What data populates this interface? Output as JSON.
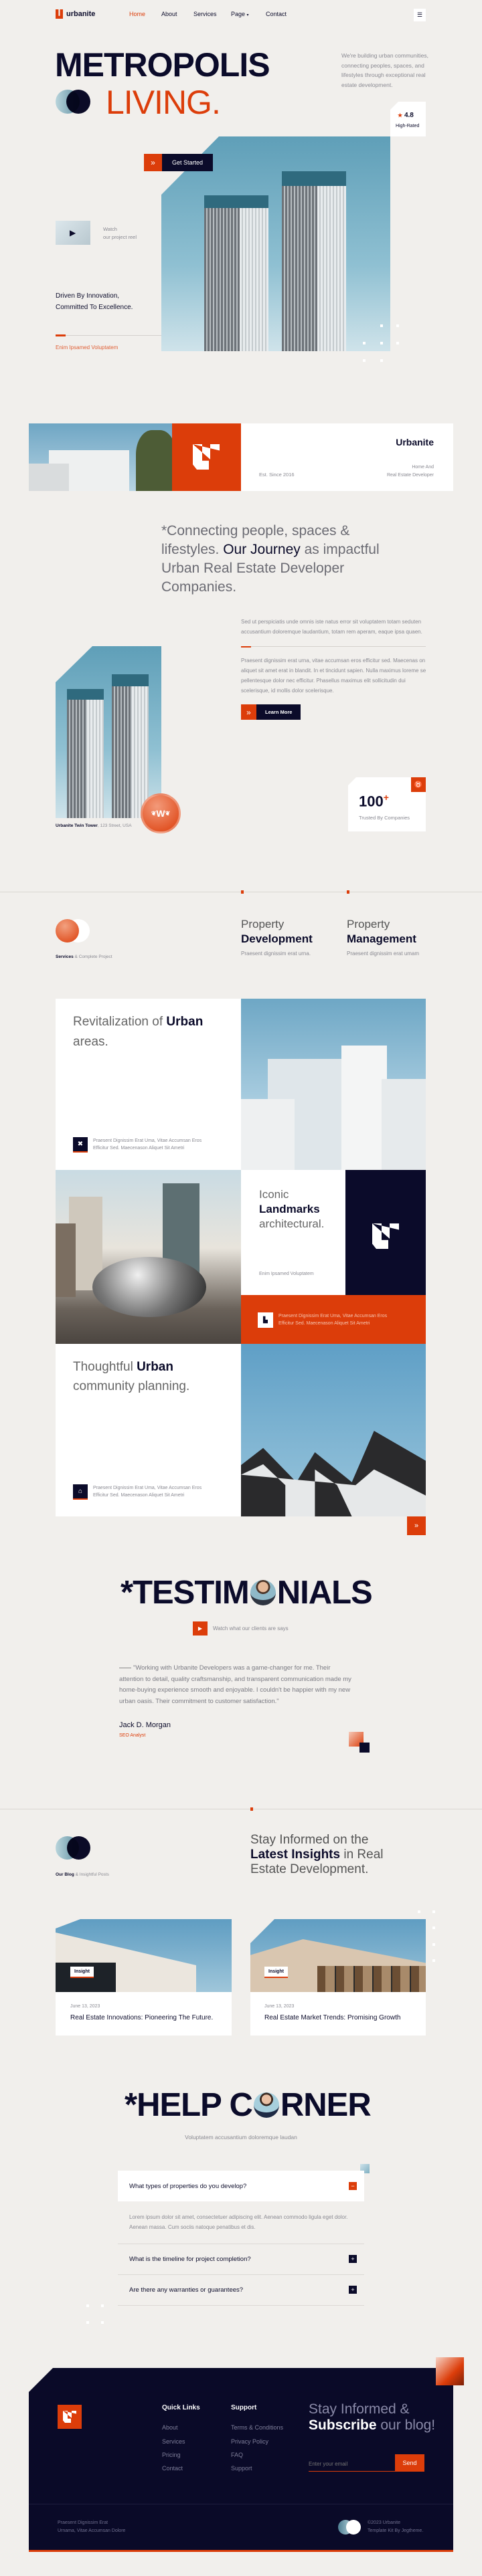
{
  "colors": {
    "accent": "#dc3d0a",
    "navy": "#0b0b2a",
    "background": "#f1efec"
  },
  "nav": {
    "brand": "urbanite",
    "items": [
      {
        "label": "Home",
        "active": true
      },
      {
        "label": "About"
      },
      {
        "label": "Services"
      },
      {
        "label": "Page",
        "dropdown": true
      },
      {
        "label": "Contact"
      }
    ],
    "menu_icon": "hamburger-icon"
  },
  "hero": {
    "title_line1": "METROPOLIS",
    "title_line2": "LIVING.",
    "intro": "We're building urban communities, connecting peoples, spaces, and lifestyles through exceptional real estate development.",
    "rating": {
      "value": "4.8",
      "label": "High-Rated"
    },
    "cta": "Get Started",
    "video": {
      "line1": "Watch",
      "line2": "our project reel"
    },
    "tagline1": "Driven By Innovation,",
    "tagline2": "Committed To Excellence.",
    "caption": "Enim Ipsamed Voluptatem"
  },
  "banner": {
    "name": "Urbanite",
    "est": "Est. Since 2016",
    "desc1": "Home And",
    "desc2": "Real Estate Developer"
  },
  "about": {
    "quote_pre": "*Connecting people, spaces & lifestyles. ",
    "quote_bold": "Our Journey",
    "quote_post": " as impactful Urban Real Estate Developer Companies.",
    "para1": "Sed ut perspiciatis unde omnis iste natus error sit voluptatem totam seduten accusantium doloremque laudantium, totam rem aperam, eaque ipsa quaen.",
    "para2": "Praesent dignissim erat urna, vitae accumsan eros efficitur sed. Maecenas on aliquet sit amet erat in blandit. In et tincidunt sapien. Nulla maximus loreme se pellentesque dolor nec efficitur. Phasellus maximus elit sollicitudin dui scelerisque, id mollis dolor scelerisque.",
    "cta": "Learn More",
    "tower_caption_bold": "Urbanite Twin Tower",
    "tower_caption": ", 123 Street, USA",
    "award_letter": "W",
    "stat_value": "100",
    "stat_suffix": "+",
    "stat_label": "Trusted By Companies"
  },
  "services": {
    "label_bold": "Services",
    "label": " & Complete Project",
    "items": [
      {
        "line1": "Property",
        "line2": "Development",
        "desc": "Praesent dignissim erat urna."
      },
      {
        "line1": "Property",
        "line2": "Management",
        "desc": "Praesent dignissim erat umam"
      }
    ],
    "cards": [
      {
        "pre": "Revitalization of ",
        "bold": "Urban",
        "post": "areas.",
        "text1": "Praesent Dignissim Erat Uma, Vitae Accumsan Eros",
        "text2": "Efficitur Sed. Maecenason Aliquet Sit Ametri",
        "icon": "tools-icon"
      },
      {
        "pre": "Iconic",
        "bold": "Landmarks",
        "post": "architectural.",
        "caption": "Enim Ipsamed Voluptatem",
        "text1": "Praesent Dignissim Erat Uma, Vitae Accumsan Eros",
        "text2": "Efficitur Sed. Maecenason Aliquet Sit Ametri",
        "icon": "factory-icon"
      },
      {
        "pre": "Thoughtful ",
        "bold": "Urban",
        "post": "community planning.",
        "text1": "Praesent Dignissim Erat Uma, Vitae Accumsan Eros",
        "text2": "Efficitur Sed. Maecenason Aliquet Sit Ametri",
        "icon": "house-icon"
      }
    ]
  },
  "testimonials": {
    "title_pre": "*TESTIM",
    "title_post": "NIALS",
    "watch": "Watch what our clients are says",
    "quote": "\"Working with Urbanite Developers was a game-changer for me. Their attention to detail, quality craftsmanship, and transparent communication made my home-buying experience smooth and enjoyable. I couldn't be happier with my new urban oasis. Their commitment to customer satisfaction.\"",
    "name": "Jack D. Morgan",
    "role": "SEO Analyst"
  },
  "blog": {
    "label_bold": "Our Blog",
    "label": " & Insightful Posts",
    "heading_pre": "Stay Informed on the ",
    "heading_bold": "Latest Insights",
    "heading_post": " in Real Estate Development.",
    "posts": [
      {
        "tag": "Insight",
        "date": "June 13, 2023",
        "title": "Real Estate Innovations: Pioneering The Future."
      },
      {
        "tag": "Insight",
        "date": "June 13, 2023",
        "title": "Real Estate Market Trends: Promising Growth"
      }
    ]
  },
  "faq": {
    "title_pre": "*HELP C",
    "title_post": "RNER",
    "subtitle": "Voluptatem accusantium doloremque laudan",
    "items": [
      {
        "q": "What types of properties do you develop?",
        "a": "Lorem ipsum dolor sit amet, consectetuer adipiscing elit. Aenean commodo ligula eget dolor. Aenean massa. Cum sociis natoque penatibus et dis.",
        "open": true
      },
      {
        "q": "What is the timeline for project completion?",
        "open": false
      },
      {
        "q": "Are there any warranties or guarantees?",
        "open": false
      }
    ]
  },
  "footer": {
    "quick_title": "Quick Links",
    "quick": [
      "About",
      "Services",
      "Pricing",
      "Contact"
    ],
    "support_title": "Support",
    "support": [
      "Terms & Conditions",
      "Privacy Policy",
      "FAQ",
      "Support"
    ],
    "sub_pre": "Stay Informed &",
    "sub_bold": "Subscribe",
    "sub_post": " our blog!",
    "email_placeholder": "Enter your email",
    "send": "Send",
    "about1": "Praesent Dignissim Erat",
    "about2": "Urnama, Vitae Accumsan Dolore",
    "copy1": "©2023 Urbanite",
    "copy2": "Template Kit By Jegtheme."
  }
}
